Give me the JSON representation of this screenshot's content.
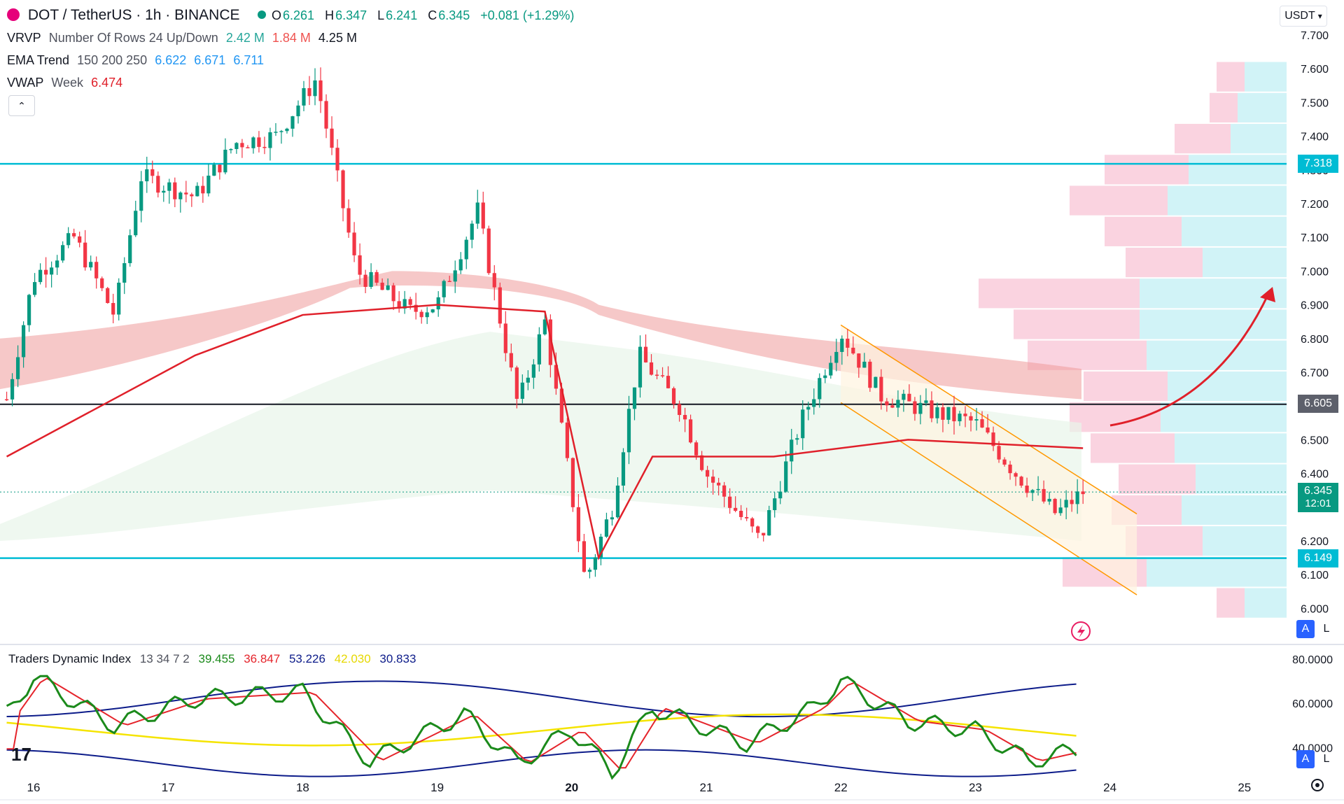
{
  "header": {
    "symbol": "DOT / TetherUS · 1h · BINANCE",
    "ohlc": [
      {
        "k": "O",
        "v": "6.261"
      },
      {
        "k": "H",
        "v": "6.347"
      },
      {
        "k": "L",
        "v": "6.241"
      },
      {
        "k": "C",
        "v": "6.345"
      }
    ],
    "change": "+0.081 (+1.29%)"
  },
  "indicators": {
    "vrvp": {
      "name": "VRVP",
      "params": "Number Of Rows 24 Up/Down",
      "v1": "2.42 M",
      "v2": "1.84 M",
      "v3": "4.25 M"
    },
    "ema": {
      "name": "EMA Trend",
      "params": "150 200 250",
      "v1": "6.622",
      "v2": "6.671",
      "v3": "6.711"
    },
    "vwap": {
      "name": "VWAP",
      "params": "Week",
      "v1": "6.474"
    }
  },
  "currency": "USDT",
  "price_axis": [
    "7.700",
    "7.600",
    "7.500",
    "7.400",
    "7.300",
    "7.200",
    "7.100",
    "7.000",
    "6.900",
    "6.800",
    "6.700",
    "6.600",
    "6.500",
    "6.400",
    "6.300",
    "6.200",
    "6.100",
    "6.000"
  ],
  "price_labels": {
    "upper_level": "7.318",
    "mid_level": "6.605",
    "last_price": "6.345",
    "countdown": "12:01",
    "lower_level": "6.149"
  },
  "scale_buttons": {
    "auto": "A",
    "log": "L"
  },
  "tdi": {
    "name": "Traders Dynamic Index",
    "params": "13 34 7 2",
    "values": [
      "39.455",
      "36.847",
      "53.226",
      "42.030",
      "30.833"
    ],
    "axis": [
      "80.0000",
      "60.0000",
      "40.0000"
    ]
  },
  "time_axis": [
    "16",
    "17",
    "18",
    "19",
    "20",
    "21",
    "22",
    "23",
    "24",
    "25"
  ],
  "colors": {
    "up": "#089981",
    "down": "#f23645",
    "vwap": "#e0202a",
    "level": "#00bcd4",
    "black_level": "#131722",
    "channel": "#ff9800",
    "tdi_green": "#1b8a1b",
    "tdi_red": "#e5242b",
    "tdi_yellow": "#f5e400",
    "tdi_blue": "#0d1c8a"
  },
  "chart_data": {
    "type": "candlestick",
    "pair": "DOT/USDT",
    "interval": "1h",
    "x_axis": "day of month",
    "x_ticks": [
      "16",
      "17",
      "18",
      "19",
      "20",
      "21",
      "22",
      "23",
      "24",
      "25"
    ],
    "ylim": [
      6.0,
      7.7
    ],
    "horizontal_levels": [
      7.318,
      6.605,
      6.149
    ],
    "last_price": 6.345,
    "approx_price_path": [
      {
        "x": 15.8,
        "y": 6.62
      },
      {
        "x": 16.0,
        "y": 6.98
      },
      {
        "x": 16.3,
        "y": 7.1
      },
      {
        "x": 16.6,
        "y": 6.87
      },
      {
        "x": 16.8,
        "y": 7.28
      },
      {
        "x": 17.2,
        "y": 7.22
      },
      {
        "x": 17.5,
        "y": 7.38
      },
      {
        "x": 17.8,
        "y": 7.4
      },
      {
        "x": 18.1,
        "y": 7.57
      },
      {
        "x": 18.4,
        "y": 7.0
      },
      {
        "x": 18.8,
        "y": 6.88
      },
      {
        "x": 19.0,
        "y": 6.9
      },
      {
        "x": 19.3,
        "y": 7.18
      },
      {
        "x": 19.6,
        "y": 6.6
      },
      {
        "x": 19.8,
        "y": 6.85
      },
      {
        "x": 20.1,
        "y": 6.08
      },
      {
        "x": 20.3,
        "y": 6.3
      },
      {
        "x": 20.5,
        "y": 6.75
      },
      {
        "x": 20.8,
        "y": 6.6
      },
      {
        "x": 21.0,
        "y": 6.4
      },
      {
        "x": 21.4,
        "y": 6.2
      },
      {
        "x": 21.7,
        "y": 6.55
      },
      {
        "x": 22.0,
        "y": 6.82
      },
      {
        "x": 22.3,
        "y": 6.63
      },
      {
        "x": 22.7,
        "y": 6.58
      },
      {
        "x": 23.0,
        "y": 6.55
      },
      {
        "x": 23.3,
        "y": 6.4
      },
      {
        "x": 23.6,
        "y": 6.28
      },
      {
        "x": 23.8,
        "y": 6.345
      }
    ],
    "vwap_path": [
      {
        "x": 15.8,
        "y": 6.45
      },
      {
        "x": 16.5,
        "y": 6.6
      },
      {
        "x": 17.2,
        "y": 6.75
      },
      {
        "x": 18.0,
        "y": 6.87
      },
      {
        "x": 19.0,
        "y": 6.9
      },
      {
        "x": 19.8,
        "y": 6.88
      },
      {
        "x": 20.2,
        "y": 6.15
      },
      {
        "x": 20.6,
        "y": 6.45
      },
      {
        "x": 21.5,
        "y": 6.45
      },
      {
        "x": 22.5,
        "y": 6.5
      },
      {
        "x": 23.8,
        "y": 6.475
      }
    ],
    "tdi_ylim": [
      25,
      85
    ],
    "tdi_green_path": [
      {
        "x": 15.8,
        "y": 55
      },
      {
        "x": 16.0,
        "y": 72
      },
      {
        "x": 16.6,
        "y": 50
      },
      {
        "x": 17.2,
        "y": 62
      },
      {
        "x": 18.0,
        "y": 65
      },
      {
        "x": 18.5,
        "y": 34
      },
      {
        "x": 19.2,
        "y": 55
      },
      {
        "x": 19.6,
        "y": 33
      },
      {
        "x": 20.0,
        "y": 48
      },
      {
        "x": 20.3,
        "y": 29
      },
      {
        "x": 20.6,
        "y": 58
      },
      {
        "x": 21.3,
        "y": 42
      },
      {
        "x": 21.8,
        "y": 58
      },
      {
        "x": 22.0,
        "y": 70
      },
      {
        "x": 22.5,
        "y": 52
      },
      {
        "x": 23.0,
        "y": 48
      },
      {
        "x": 23.4,
        "y": 34
      },
      {
        "x": 23.8,
        "y": 39.455
      }
    ]
  }
}
